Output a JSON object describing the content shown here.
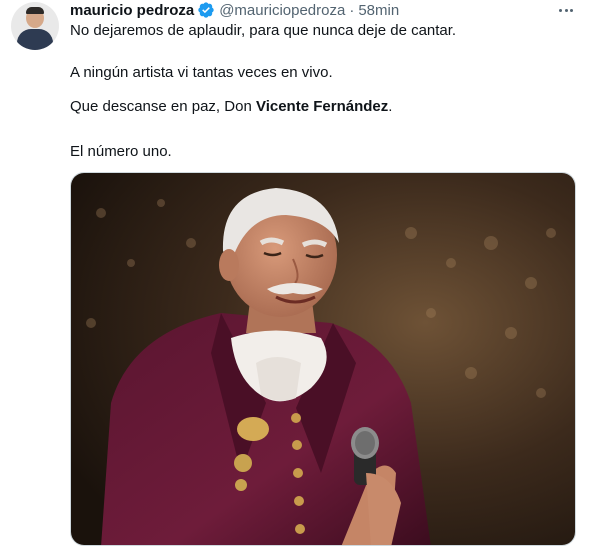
{
  "tweet": {
    "author_name": "mauricio pedroza",
    "handle": "@mauriciopedroza",
    "separator": "·",
    "time": "58min",
    "verified": true,
    "paragraphs": {
      "p1": "No dejaremos de aplaudir, para que nunca deje de cantar.",
      "p2": "A ningún artista vi tantas veces en vivo.",
      "p3_prefix": "Que descanse en paz, Don ",
      "p3_bold": "Vicente Fernández",
      "p3_suffix": ".",
      "p4": "El número uno."
    },
    "icons": {
      "verified": "verified-badge-icon",
      "more": "more-options-icon"
    },
    "colors": {
      "verified_badge": "#1d9bf0",
      "secondary_text": "#536471",
      "primary_text": "#0f1419"
    }
  }
}
